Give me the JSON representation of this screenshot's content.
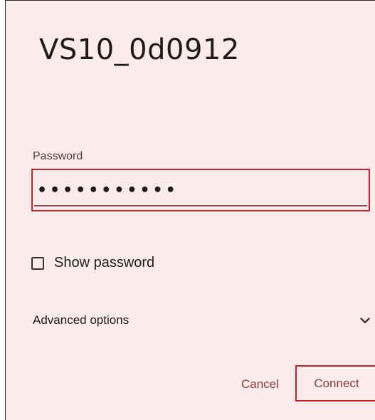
{
  "dialog": {
    "title": "VS10_0d0912",
    "password": {
      "label": "Password",
      "masked_value": "•••••••••••"
    },
    "show_password": {
      "label": "Show password",
      "checked": false
    },
    "advanced": {
      "label": "Advanced options",
      "icon": "chevron-down-icon"
    },
    "buttons": {
      "cancel": "Cancel",
      "connect": "Connect"
    }
  },
  "colors": {
    "dialog_bg": "#fbeceb",
    "accent": "#8b3a3a",
    "highlight_border": "#d11f2a"
  }
}
